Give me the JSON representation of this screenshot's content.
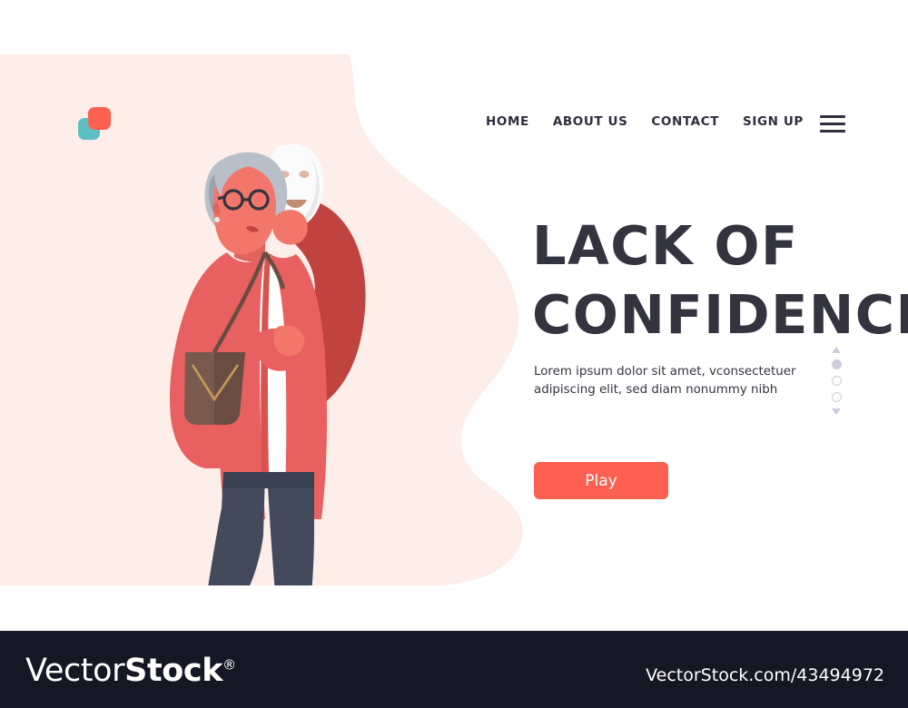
{
  "brand": {
    "logo_name": "overlapping-squares-logo",
    "logo_color_front": "#fc6050",
    "logo_color_back": "#5bbfc4"
  },
  "nav": {
    "items": [
      {
        "label": "HOME"
      },
      {
        "label": "ABOUT US"
      },
      {
        "label": "CONTACT"
      },
      {
        "label": "SIGN UP"
      }
    ],
    "menu_icon": "hamburger-menu-icon"
  },
  "hero": {
    "headline_line1": "LACK OF",
    "headline_line2": "CONFIDENCE",
    "paragraph": "Lorem ipsum dolor sit amet, vconsectetuer adipiscing elit, sed diam nonummy nibh",
    "cta_label": "Play",
    "cta_color": "#fc6050",
    "background_blob_color": "#fdeee9",
    "headline_color": "#33343f"
  },
  "pager": {
    "up_arrow": "chevron-up-icon",
    "down_arrow": "chevron-down-icon",
    "dots": [
      {
        "active": true
      },
      {
        "active": false
      },
      {
        "active": false
      }
    ],
    "color": "#cdccdb"
  },
  "illustration": {
    "name": "elderly-woman-holding-mask",
    "colors": {
      "coat": "#e86060",
      "coat_shadow": "#c0433f",
      "shirt": "#ffffff",
      "pants": "#434a5c",
      "shoes": "#3a4252",
      "skin": "#f2776a",
      "skin_shadow": "#e0645c",
      "hair": "#b8bfc9",
      "hair_shadow": "#9aa3b0",
      "bag": "#7a5a4e",
      "bag_strap": "#6a4d42",
      "bag_chain": "#c49a5a",
      "mask": "#fbfbfb",
      "mask_shadow": "#e8e8ea",
      "glasses": "#33343f",
      "ground_shadow": "#f7ddd6"
    }
  },
  "footer": {
    "wordmark_thin": "Vector",
    "wordmark_bold": "Stock",
    "wordmark_reg": "®",
    "url": "VectorStock.com/43494972",
    "background": "#151724"
  }
}
